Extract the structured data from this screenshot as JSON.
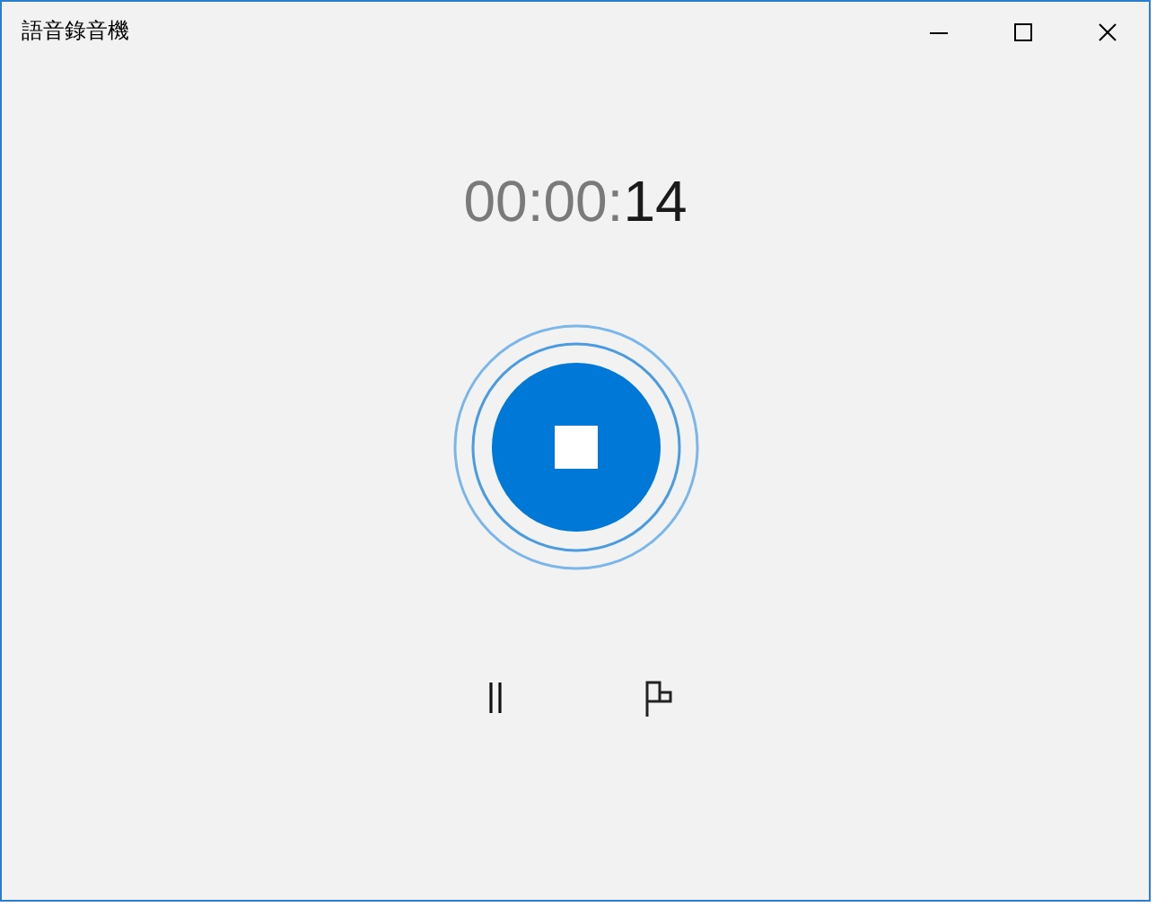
{
  "window": {
    "title": "語音錄音機"
  },
  "timer": {
    "leading": "00:00:",
    "seconds": "14"
  },
  "record_button": {
    "recording": true
  },
  "controls": [
    {
      "kind": "pause"
    },
    {
      "kind": "flag"
    }
  ]
}
